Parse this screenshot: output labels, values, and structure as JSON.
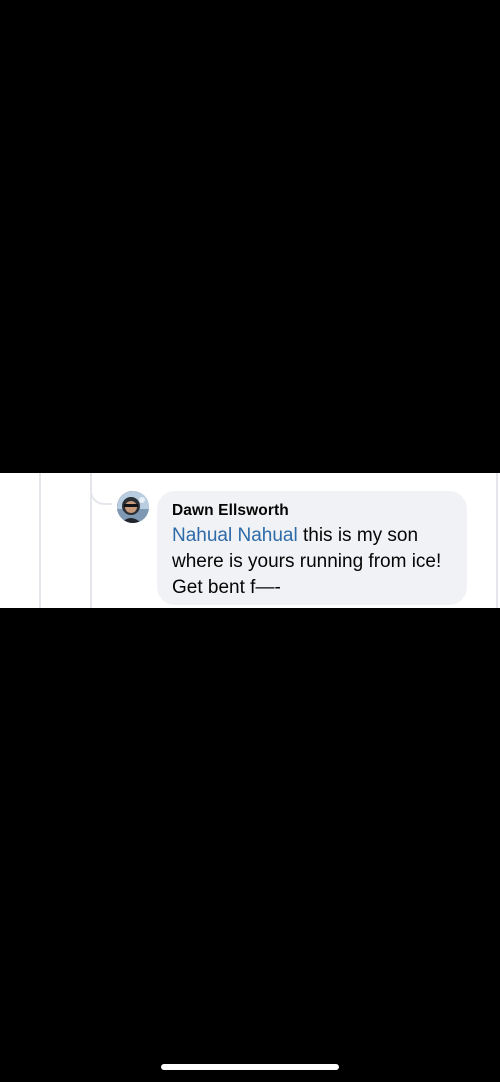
{
  "comment": {
    "author": "Dawn Ellsworth",
    "mention": "Nahual Nahual",
    "text_after_mention": " this is my son where is yours running from ice! Get bent f—-",
    "avatar_label": "avatar"
  },
  "colors": {
    "background": "#000000",
    "strip_background": "#ffffff",
    "bubble_background": "#f0f2f5",
    "mention_color": "#2d6aa8",
    "text_color": "#050505",
    "thread_line_color": "#e4e6eb",
    "home_indicator": "#ffffff"
  },
  "icons": {
    "avatar": "profile-photo"
  }
}
